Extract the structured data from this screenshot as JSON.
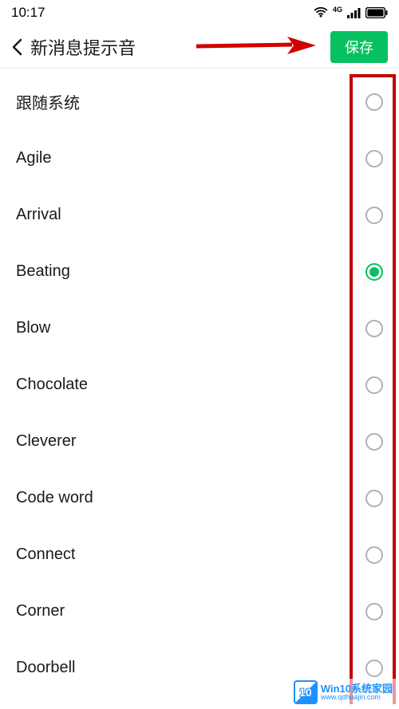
{
  "status_bar": {
    "time": "10:17",
    "network_label": "4G"
  },
  "header": {
    "title": "新消息提示音",
    "save_label": "保存"
  },
  "list": {
    "items": [
      {
        "label": "跟随系统",
        "selected": false
      },
      {
        "label": "Agile",
        "selected": false
      },
      {
        "label": "Arrival",
        "selected": false
      },
      {
        "label": "Beating",
        "selected": true
      },
      {
        "label": "Blow",
        "selected": false
      },
      {
        "label": "Chocolate",
        "selected": false
      },
      {
        "label": "Cleverer",
        "selected": false
      },
      {
        "label": "Code word",
        "selected": false
      },
      {
        "label": "Connect",
        "selected": false
      },
      {
        "label": "Corner",
        "selected": false
      },
      {
        "label": "Doorbell",
        "selected": false
      }
    ]
  },
  "watermark": {
    "logo_text": "10",
    "main": "Win10系统家园",
    "sub": "www.qdhuajin.com"
  }
}
